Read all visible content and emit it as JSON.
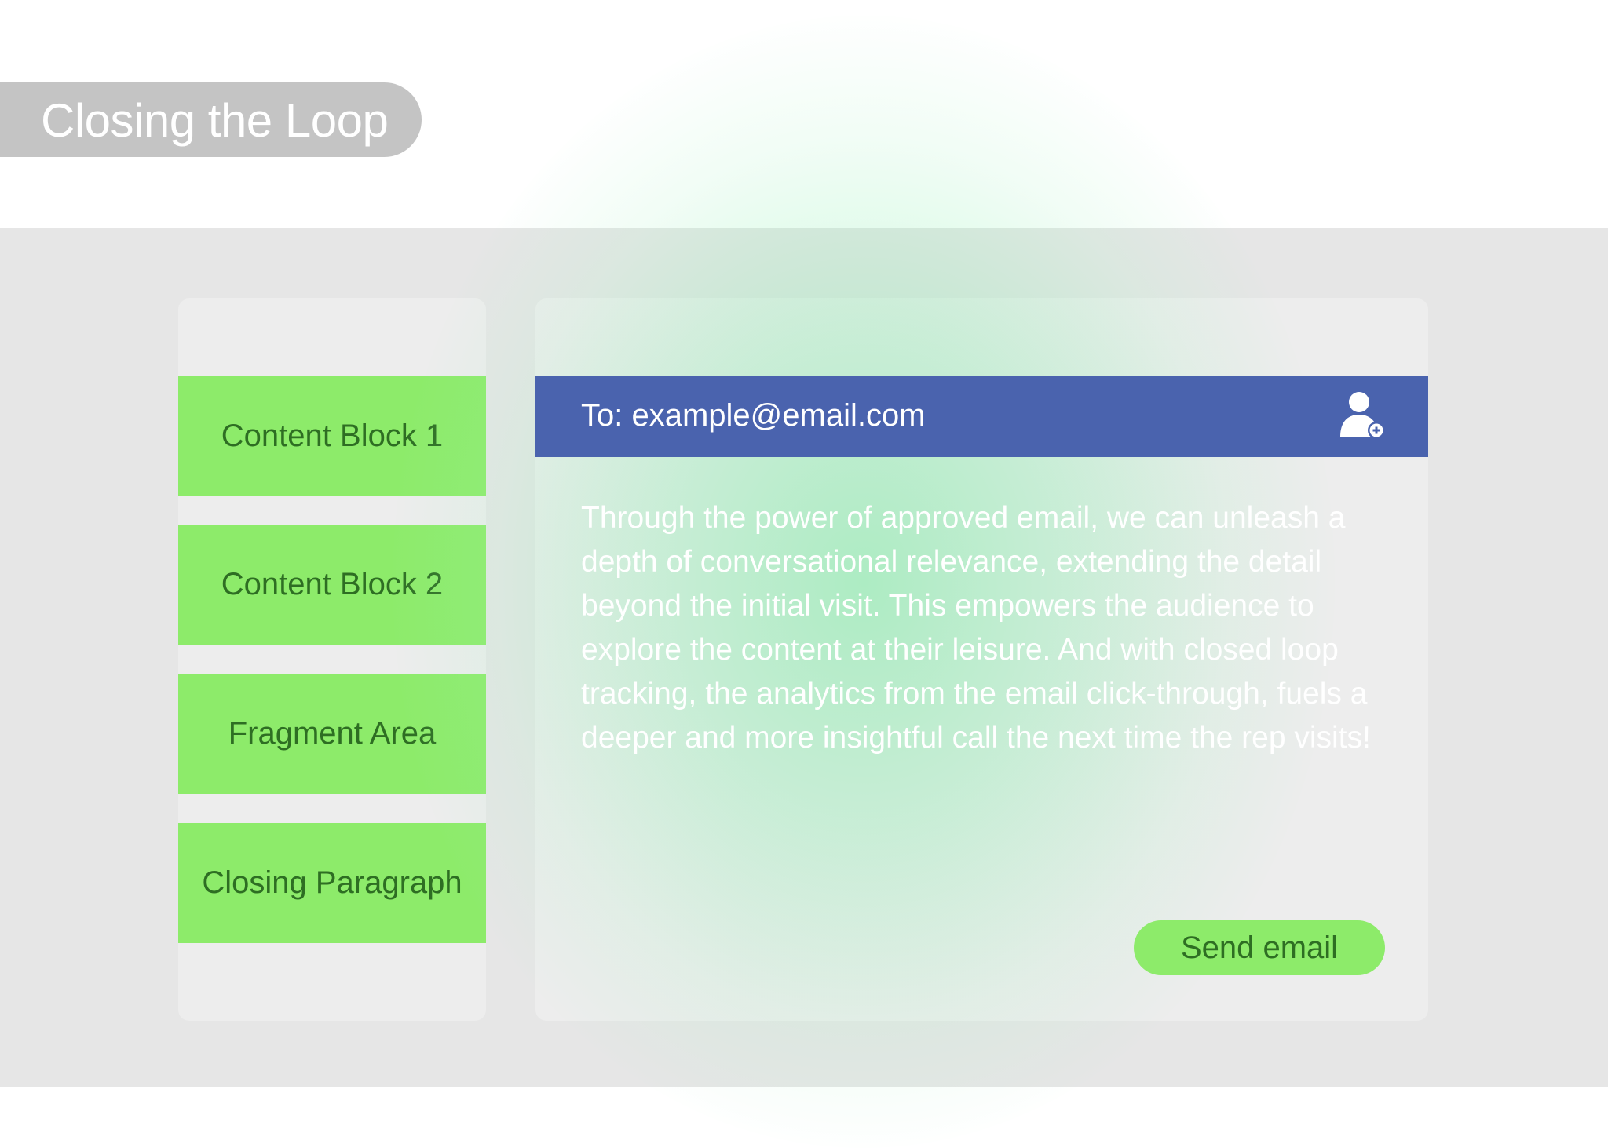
{
  "header": {
    "title": "Closing the Loop"
  },
  "sidebar": {
    "items": [
      {
        "label": "Content Block 1"
      },
      {
        "label": "Content Block 2"
      },
      {
        "label": "Fragment Area"
      },
      {
        "label": "Closing Paragraph"
      }
    ]
  },
  "email": {
    "to_label": "To: example@email.com",
    "body": "Through the power of approved email, we can unleash a depth of conversational relevance, extending the detail beyond the initial visit. This empowers the audience to explore the content at their leisure. And with closed loop tracking, the analytics from the email click-through, fuels a deeper and more insightful call the next time the rep visits!",
    "send_label": "Send email",
    "add_contact_icon": "add-user-icon"
  },
  "colors": {
    "block_green": "#8deb6a",
    "block_text": "#2e6e23",
    "header_blue": "#4a63ae",
    "band_gray": "#e6e6e6",
    "title_pill_gray": "#c4c4c4",
    "glow_green": "#78eba0"
  }
}
